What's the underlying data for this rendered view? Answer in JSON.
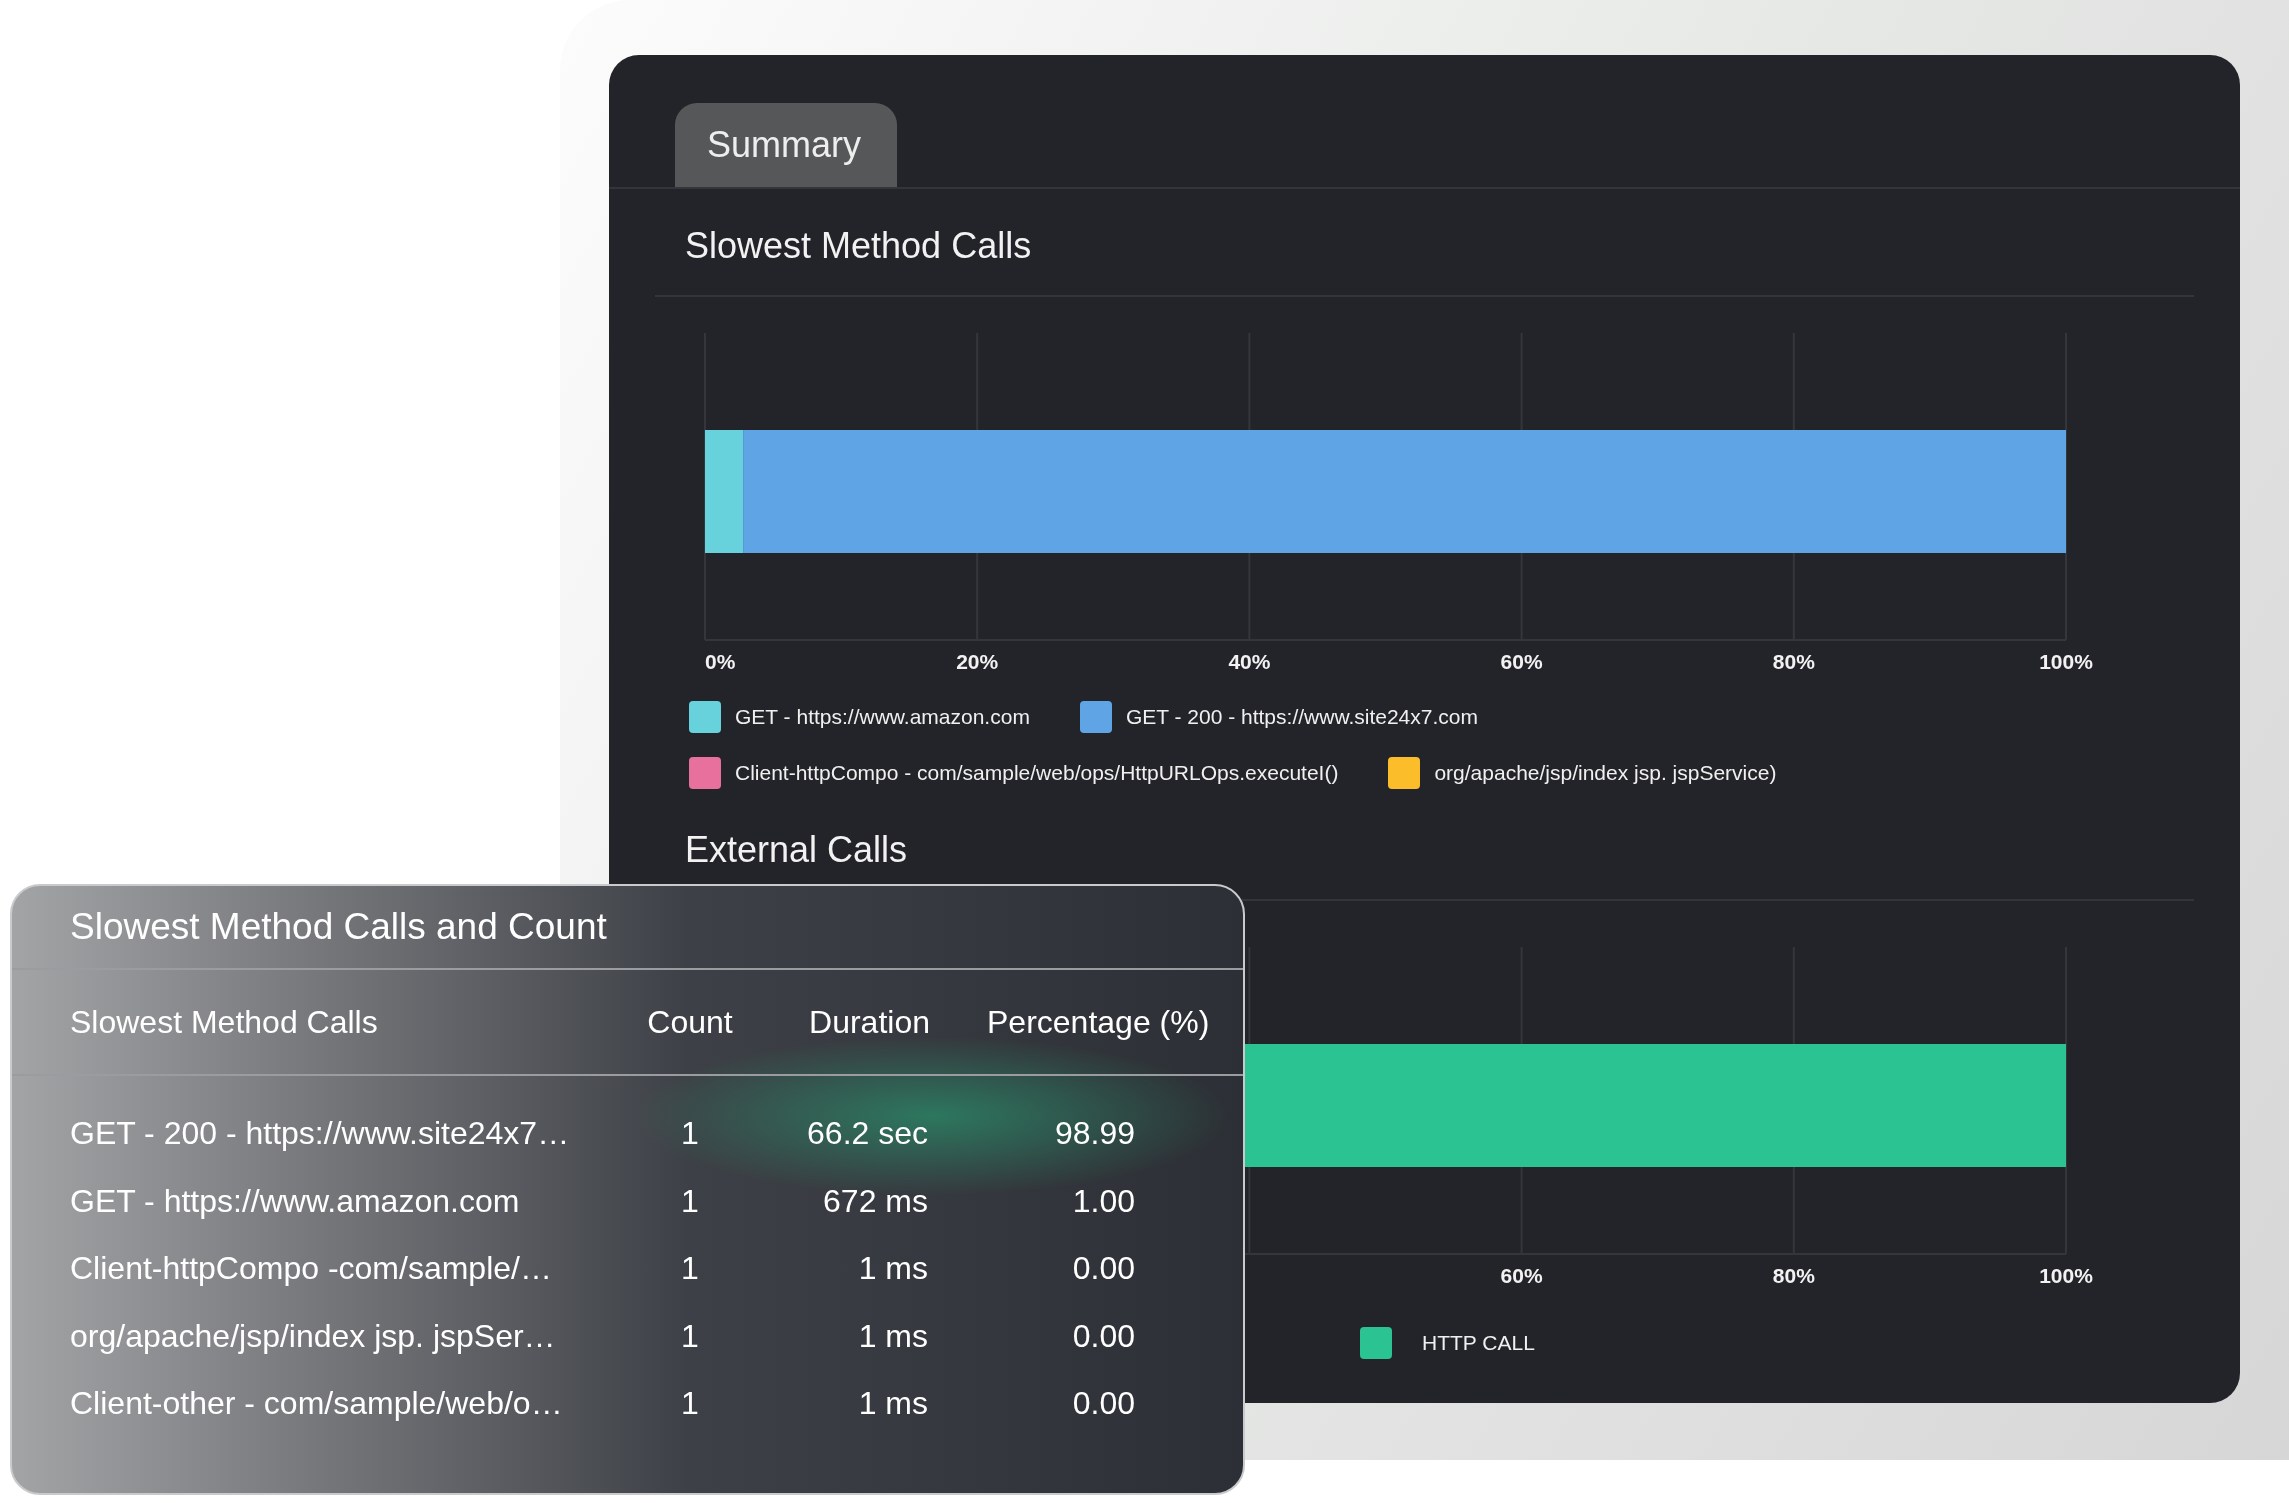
{
  "tabs": [
    {
      "label": "Summary",
      "selected": true
    }
  ],
  "sections": [
    {
      "title": "Slowest Method Calls",
      "chart_data": {
        "type": "bar",
        "orientation": "horizontal",
        "stacked": true,
        "grid": true,
        "xlim": [
          0,
          100
        ],
        "xticks": [
          {
            "value": 0,
            "label": "0%"
          },
          {
            "value": 20,
            "label": "20%"
          },
          {
            "value": 40,
            "label": "40%"
          },
          {
            "value": 60,
            "label": "60%"
          },
          {
            "value": 80,
            "label": "80%"
          },
          {
            "value": 100,
            "label": "100%"
          }
        ],
        "series": [
          {
            "name": "GET - https://www.amazon.com",
            "color": "#67d1dc",
            "values": [
              2.8
            ]
          },
          {
            "name": "GET - 200 - https://www.site24x7.com",
            "color": "#5fa5e6",
            "values": [
              97.2
            ]
          },
          {
            "name": "Client-httpCompo - com/sample/web/ops/HttpURLOps.executeI()",
            "color": "#e8709c",
            "values": [
              0
            ]
          },
          {
            "name": "org/apache/jsp/index jsp. jspService)",
            "color": "#fbbd2a",
            "values": [
              0
            ]
          }
        ]
      }
    },
    {
      "title": "External Calls",
      "chart_data": {
        "type": "bar",
        "orientation": "horizontal",
        "stacked": true,
        "grid": true,
        "xlim": [
          0,
          100
        ],
        "xticks": [
          {
            "value": 60,
            "label": "60%"
          },
          {
            "value": 80,
            "label": "80%"
          },
          {
            "value": 100,
            "label": "100%"
          }
        ],
        "series": [
          {
            "name": "HTTP CALL",
            "color": "#2ac391",
            "values": [
              100
            ]
          }
        ]
      }
    }
  ],
  "overlay": {
    "title": "Slowest Method Calls and Count",
    "columns": [
      "Slowest Method Calls",
      "Count",
      "Duration",
      "Percentage (%)"
    ],
    "rows": [
      [
        "GET - 200 - https://www.site24x7…",
        "1",
        "66.2 sec",
        "98.99"
      ],
      [
        "GET - https://www.amazon.com",
        "1",
        "672 ms",
        "1.00"
      ],
      [
        "Client-httpCompo -com/sample/…",
        "1",
        "1 ms",
        "0.00"
      ],
      [
        "org/apache/jsp/index jsp. jspSer…",
        "1",
        "1 ms",
        "0.00"
      ],
      [
        "Client-other - com/sample/web/o…",
        "1",
        "1 ms",
        "0.00"
      ]
    ]
  }
}
